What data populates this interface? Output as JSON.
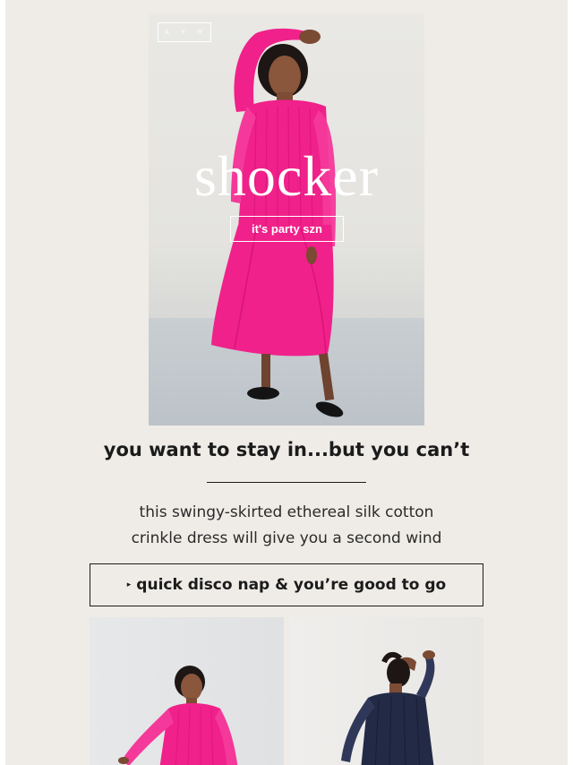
{
  "hero": {
    "logo": "A Y R",
    "title": "shocker",
    "tag": "it's party szn"
  },
  "headline": "you want to stay in...but you can’t",
  "body_lines": [
    "this swingy-skirted ethereal silk cotton",
    "crinkle dress will give you a second wind"
  ],
  "cta": {
    "arrow": "▸",
    "label": "quick disco nap & you’re good to go"
  },
  "colors": {
    "background": "#efece7",
    "dress_pink": "#f0218a",
    "dress_navy": "#232a45",
    "text": "#1b1b1b"
  }
}
